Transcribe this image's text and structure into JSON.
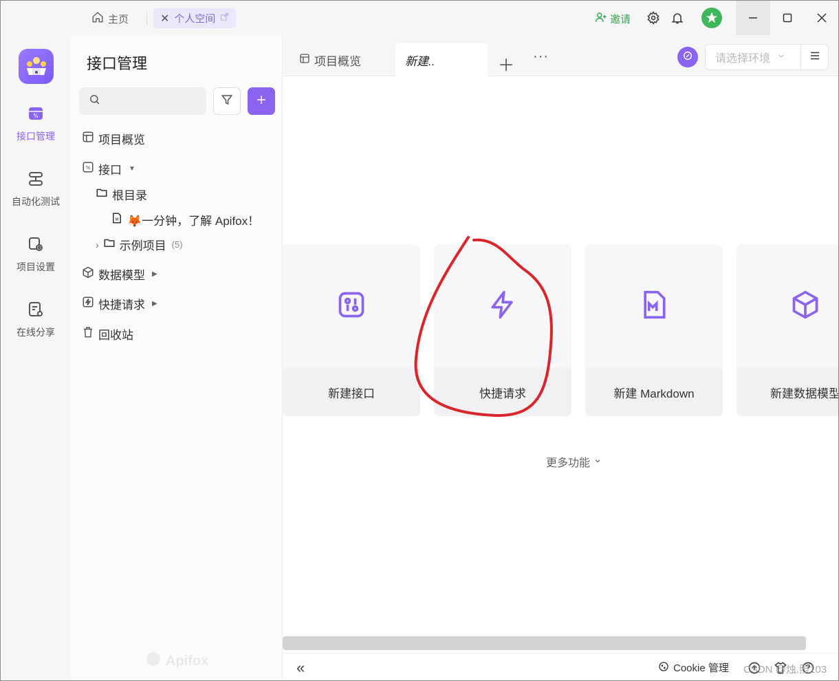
{
  "titlebar": {
    "home_label": "主页",
    "space_tab_label": "个人空间",
    "invite_label": "邀请"
  },
  "rail": {
    "items": [
      {
        "label": "接口管理",
        "icon": "api-icon"
      },
      {
        "label": "自动化测试",
        "icon": "automation-icon"
      },
      {
        "label": "项目设置",
        "icon": "project-settings-icon"
      },
      {
        "label": "在线分享",
        "icon": "share-icon"
      }
    ]
  },
  "sidebar": {
    "title": "接口管理",
    "search_placeholder": "",
    "tree": {
      "overview": "项目概览",
      "api": "接口",
      "root_dir": "根目录",
      "doc_item": "🦊一分钟，了解 Apifox！",
      "example_project": "示例项目",
      "example_count": "(5)",
      "data_model": "数据模型",
      "quick_request": "快捷请求",
      "recycle_bin": "回收站"
    },
    "watermark": "Apifox"
  },
  "main": {
    "tabs": [
      {
        "label": "项目概览"
      },
      {
        "label": "新建.."
      }
    ],
    "env_placeholder": "请选择环境",
    "cards": [
      {
        "label": "新建接口",
        "icon": "api-icon"
      },
      {
        "label": "快捷请求",
        "icon": "lightning-icon"
      },
      {
        "label": "新建 Markdown",
        "icon": "markdown-icon"
      },
      {
        "label": "新建数据模型",
        "icon": "cube-icon"
      }
    ],
    "more_functions": "更多功能"
  },
  "bottombar": {
    "cookie_label": "Cookie 管理",
    "watermark": "CSDN @烛.照103"
  },
  "colors": {
    "accent": "#8a63f0",
    "invite_green": "#33a852",
    "annotation_red": "#d9262b"
  }
}
